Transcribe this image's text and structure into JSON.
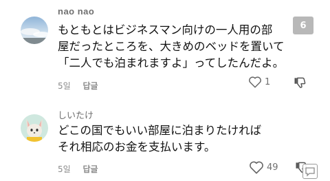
{
  "comments": [
    {
      "author": "nao nao",
      "lines": [
        "もともとはビジネスマン向けの一人用の部",
        "屋だったところを、大きめのベッドを置いて",
        "「二人でも泊まれますよ」ってしたんだよ。"
      ],
      "time": "5일",
      "reply_label": "답글",
      "likes": "1",
      "reply_count": "6"
    },
    {
      "author": "しいたけ",
      "lines": [
        "どこの国でもいい部屋に泊まりたければ",
        "それ相応のお金を支払います。"
      ],
      "time": "5일",
      "reply_label": "답글",
      "likes": "49"
    }
  ]
}
